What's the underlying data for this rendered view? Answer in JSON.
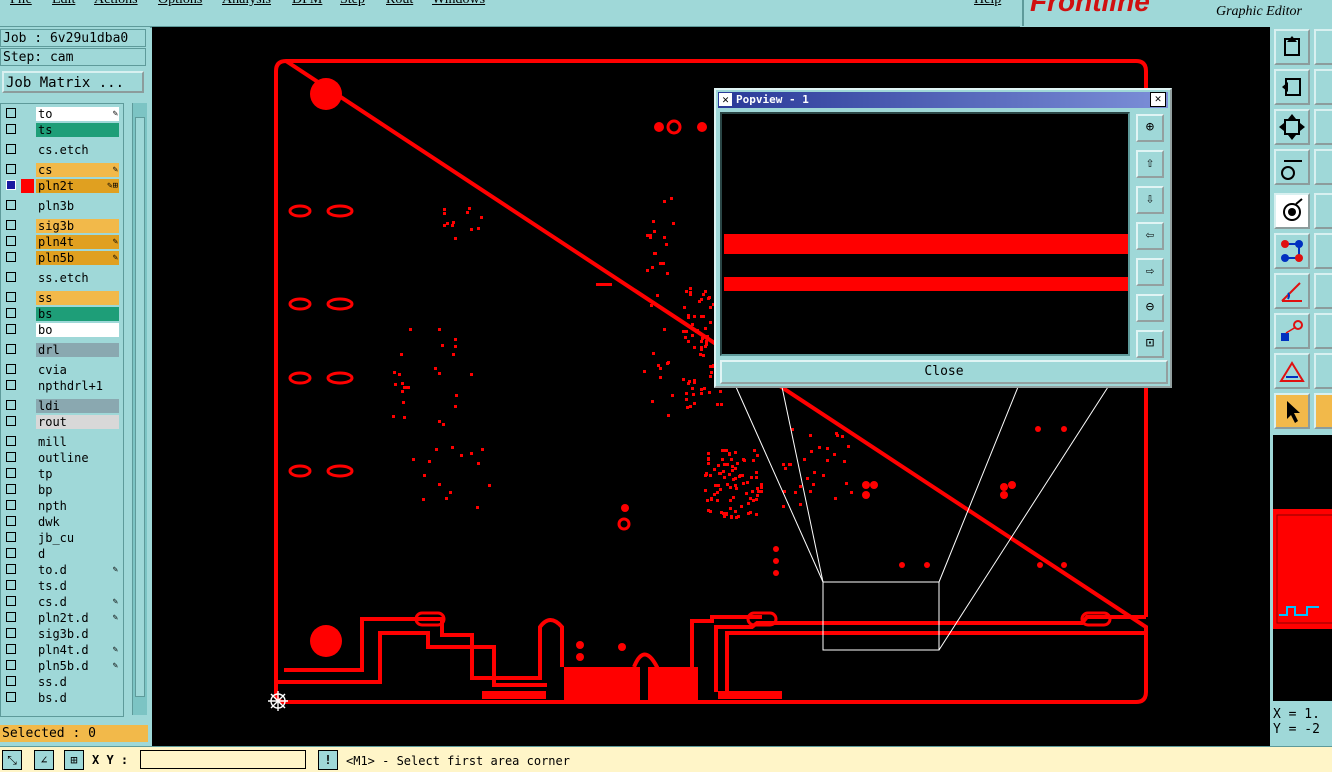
{
  "menu": {
    "items": [
      "File",
      "Edit",
      "Actions",
      "Options",
      "Analysis",
      "DFM",
      "Step",
      "Rout",
      "Windows"
    ],
    "help": "Help"
  },
  "logo": {
    "brand": "Frontline",
    "subtitle": "Graphic Editor"
  },
  "job": {
    "job_line": "Job : 6v29u1dba0",
    "step_line": "Step: cam"
  },
  "job_matrix_button": "Job Matrix ...",
  "layers": [
    {
      "name": "to",
      "color": "#ffffff",
      "icon": "✎"
    },
    {
      "name": "ts",
      "color": "#1e9e78",
      "icon": ""
    },
    {
      "name": "cs.etch",
      "color": "#9fd8d8",
      "icon": ""
    },
    {
      "name": "cs",
      "color": "#f2b94a",
      "icon": "✎"
    },
    {
      "name": "pln2t",
      "color": "#e0a020",
      "icon": "✎⊞",
      "swatch": "#ff0000",
      "checked": true
    },
    {
      "name": "pln3b",
      "color": "#9fd8d8",
      "icon": ""
    },
    {
      "name": "sig3b",
      "color": "#f2b94a",
      "icon": ""
    },
    {
      "name": "pln4t",
      "color": "#e0a020",
      "icon": "✎"
    },
    {
      "name": "pln5b",
      "color": "#e0a020",
      "icon": "✎"
    },
    {
      "name": "ss.etch",
      "color": "#9fd8d8",
      "icon": ""
    },
    {
      "name": "ss",
      "color": "#f2b94a",
      "icon": ""
    },
    {
      "name": "bs",
      "color": "#1e9e78",
      "icon": ""
    },
    {
      "name": "bo",
      "color": "#ffffff",
      "icon": ""
    },
    {
      "name": "drl",
      "color": "#8aa8b0",
      "icon": ""
    },
    {
      "name": "cvia",
      "color": "#9fd8d8",
      "icon": ""
    },
    {
      "name": "npthdrl+1",
      "color": "#9fd8d8",
      "icon": ""
    },
    {
      "name": "ldi",
      "color": "#8aa8b0",
      "icon": ""
    },
    {
      "name": "rout",
      "color": "#d8d8d8",
      "icon": ""
    },
    {
      "name": "mill",
      "color": "#9fd8d8",
      "icon": ""
    },
    {
      "name": "outline",
      "color": "#9fd8d8",
      "icon": ""
    },
    {
      "name": "tp",
      "color": "#9fd8d8",
      "icon": ""
    },
    {
      "name": "bp",
      "color": "#9fd8d8",
      "icon": ""
    },
    {
      "name": "npth",
      "color": "#9fd8d8",
      "icon": ""
    },
    {
      "name": "dwk",
      "color": "#9fd8d8",
      "icon": ""
    },
    {
      "name": "jb_cu",
      "color": "#9fd8d8",
      "icon": ""
    },
    {
      "name": "d",
      "color": "#9fd8d8",
      "icon": ""
    },
    {
      "name": "to.d",
      "color": "#9fd8d8",
      "icon": "✎"
    },
    {
      "name": "ts.d",
      "color": "#9fd8d8",
      "icon": ""
    },
    {
      "name": "cs.d",
      "color": "#9fd8d8",
      "icon": "✎"
    },
    {
      "name": "pln2t.d",
      "color": "#9fd8d8",
      "icon": "✎"
    },
    {
      "name": "sig3b.d",
      "color": "#9fd8d8",
      "icon": ""
    },
    {
      "name": "pln4t.d",
      "color": "#9fd8d8",
      "icon": "✎"
    },
    {
      "name": "pln5b.d",
      "color": "#9fd8d8",
      "icon": "✎"
    },
    {
      "name": "ss.d",
      "color": "#9fd8d8",
      "icon": ""
    },
    {
      "name": "bs.d",
      "color": "#9fd8d8",
      "icon": ""
    }
  ],
  "selected_label": "Selected : 0",
  "status": {
    "xy_label": "X Y :",
    "xy_value": "",
    "prompt": "<M1> - Select first area corner"
  },
  "coords": {
    "x": "X = 1.",
    "y": "Y = -2"
  },
  "popview": {
    "title": "Popview - 1",
    "close_label": "Close"
  },
  "colors": {
    "panel": "#9fd8d8",
    "canvas": "#000000",
    "copper": "#ff0000",
    "selected_bg": "#f2b94a",
    "status_bg": "#fff5c8"
  }
}
